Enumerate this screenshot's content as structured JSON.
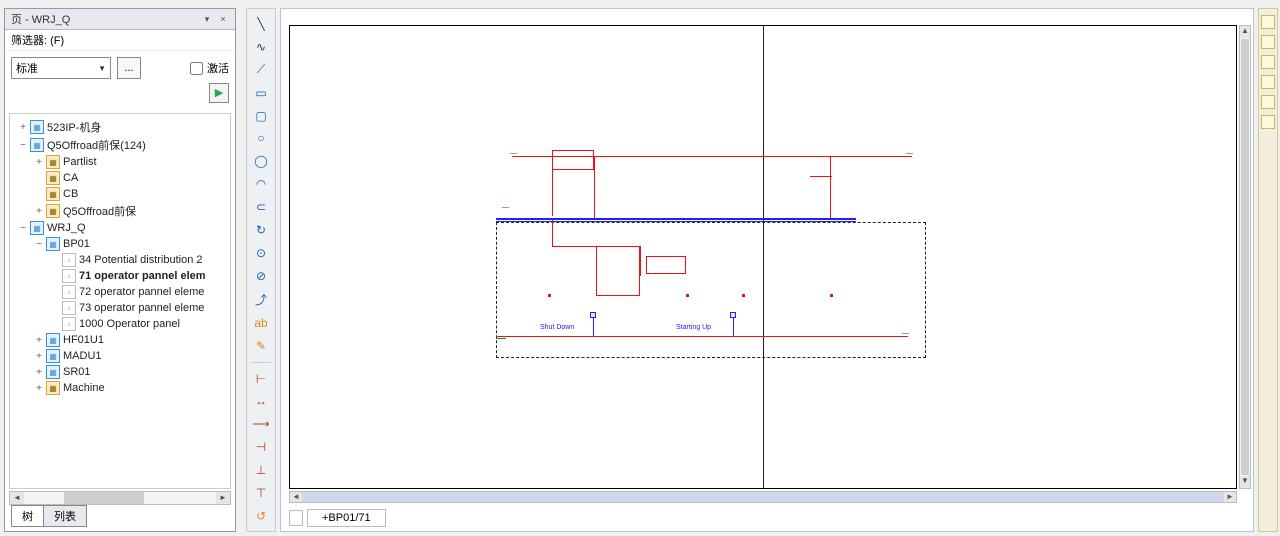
{
  "panel": {
    "title": "页 - WRJ_Q",
    "filter_label": "筛选器: (F)",
    "filter_value": "标准",
    "filter_ellipsis": "...",
    "activate_label": "激活",
    "run_glyph": "▶"
  },
  "tree": [
    {
      "indent": 0,
      "tw": "+",
      "icon": "blue",
      "label": "523IP-机身",
      "bold": false
    },
    {
      "indent": 0,
      "tw": "−",
      "icon": "blue",
      "label": "Q5Offroad前保(124)",
      "bold": false
    },
    {
      "indent": 1,
      "tw": "+",
      "icon": "yel",
      "label": "Partlist",
      "bold": false
    },
    {
      "indent": 1,
      "tw": "",
      "icon": "yel",
      "label": "CA",
      "bold": false
    },
    {
      "indent": 1,
      "tw": "",
      "icon": "yel",
      "label": "CB",
      "bold": false
    },
    {
      "indent": 1,
      "tw": "+",
      "icon": "yel",
      "label": "Q5Offroad前保",
      "bold": false
    },
    {
      "indent": 0,
      "tw": "−",
      "icon": "blue",
      "label": "WRJ_Q",
      "bold": false
    },
    {
      "indent": 1,
      "tw": "−",
      "icon": "blue",
      "label": "BP01",
      "bold": false
    },
    {
      "indent": 2,
      "tw": "",
      "icon": "page",
      "label": "34 Potential distribution 2",
      "bold": false
    },
    {
      "indent": 2,
      "tw": "",
      "icon": "page",
      "label": "71 operator pannel elem",
      "bold": true
    },
    {
      "indent": 2,
      "tw": "",
      "icon": "page",
      "label": "72 operator pannel eleme",
      "bold": false
    },
    {
      "indent": 2,
      "tw": "",
      "icon": "page",
      "label": "73 operator pannel eleme",
      "bold": false
    },
    {
      "indent": 2,
      "tw": "",
      "icon": "page",
      "label": "1000 Operator panel",
      "bold": false
    },
    {
      "indent": 1,
      "tw": "+",
      "icon": "blue",
      "label": "HF01U1",
      "bold": false
    },
    {
      "indent": 1,
      "tw": "+",
      "icon": "blue",
      "label": "MADU1",
      "bold": false
    },
    {
      "indent": 1,
      "tw": "+",
      "icon": "blue",
      "label": "SR01",
      "bold": false
    },
    {
      "indent": 1,
      "tw": "+",
      "icon": "yel",
      "label": "Machine",
      "bold": false
    }
  ],
  "bottom_tabs": {
    "tree": "树",
    "list": "列表"
  },
  "tool_icons": [
    "╲",
    "∿",
    "⟋",
    "▭",
    "▢",
    "○",
    "◯",
    "◠",
    "⊂",
    "↻",
    "⊙",
    "⊘",
    "⤴",
    "ab",
    "✎",
    "—",
    "⊢",
    "↔",
    "⟶",
    "⊣",
    "⊥",
    "⊤",
    "↺"
  ],
  "tool_colors": [
    "c-dark",
    "c-dark",
    "c-blue",
    "c-blue",
    "c-blue",
    "c-blue",
    "c-blue",
    "c-blue",
    "c-blue",
    "c-blue",
    "c-blue",
    "c-blue",
    "c-blue",
    "c-orange",
    "c-orange",
    "c-dark",
    "c-red",
    "c-red",
    "c-red",
    "c-red",
    "c-red",
    "c-red",
    "c-orange"
  ],
  "canvas": {
    "page_tab": "+BP01/71",
    "labels": {
      "shutdown": "Shut Down",
      "startup": "Starting Up"
    }
  },
  "right_rail_count": 6
}
